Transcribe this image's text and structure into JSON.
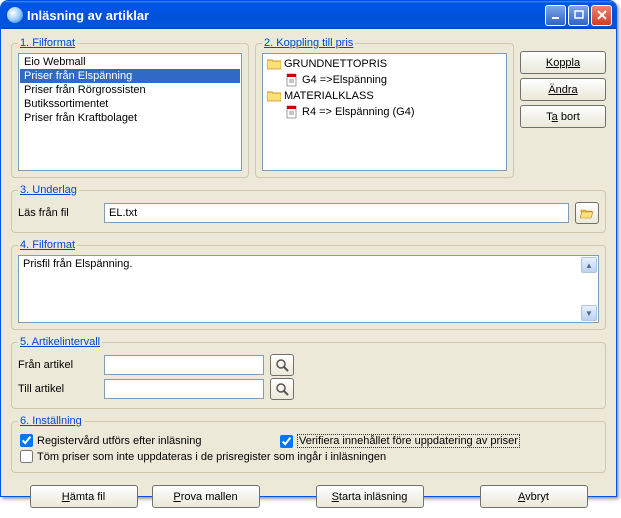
{
  "window": {
    "title": "Inläsning av artiklar"
  },
  "sections": {
    "filformat1": {
      "num": "1",
      "label": "Filformat"
    },
    "koppling": {
      "num": "2",
      "label": "Koppling till pris"
    },
    "underlag": {
      "num": "3",
      "label": "Underlag"
    },
    "filformat2": {
      "num": "4",
      "label": "Filformat"
    },
    "artikel": {
      "num": "5",
      "label": "Artikelintervall"
    },
    "inst": {
      "num": "6",
      "label": "Inställning"
    }
  },
  "list": {
    "items": [
      "Eio Webmall",
      "Priser från Elspänning",
      "Priser från Rörgrossisten",
      "Butikssortimentet",
      "Priser från Kraftbolaget"
    ],
    "selected_index": 1
  },
  "tree": [
    {
      "level": 0,
      "icon": "folder",
      "text": "GRUNDNETTOPRIS"
    },
    {
      "level": 1,
      "icon": "doc",
      "text": "G4   =>Elspänning"
    },
    {
      "level": 0,
      "icon": "folder",
      "text": "MATERIALKLASS"
    },
    {
      "level": 1,
      "icon": "doc",
      "text": "R4    => Elspänning (G4)"
    }
  ],
  "side_buttons": {
    "koppla": "Koppla",
    "andra": "Ändra",
    "tabort_pre": "T",
    "tabort_u": "a",
    "tabort_post": " bort"
  },
  "underlag": {
    "las_label": "Läs från fil",
    "filename": "EL.txt"
  },
  "filformat_text": "Prisfil från Elspänning.",
  "artikel": {
    "fran_label": "Från artikel",
    "till_label": "Till artikel",
    "fran_value": "",
    "till_value": ""
  },
  "inst": {
    "c1_label": "Registervård utförs efter inläsning",
    "c1_checked": true,
    "c2_label": "Verifiera innehållet före uppdatering av priser",
    "c2_checked": true,
    "c3_label": "Töm priser som inte uppdateras i de prisregister som ingår i inläsningen",
    "c3_checked": false
  },
  "buttons": {
    "hamta_pre": "",
    "hamta_u": "H",
    "hamta_post": "ämta fil",
    "prova_pre": "",
    "prova_u": "P",
    "prova_post": "rova mallen",
    "starta_pre": "",
    "starta_u": "S",
    "starta_post": "tarta inläsning",
    "avbryt_pre": "",
    "avbryt_u": "A",
    "avbryt_post": "vbryt"
  }
}
